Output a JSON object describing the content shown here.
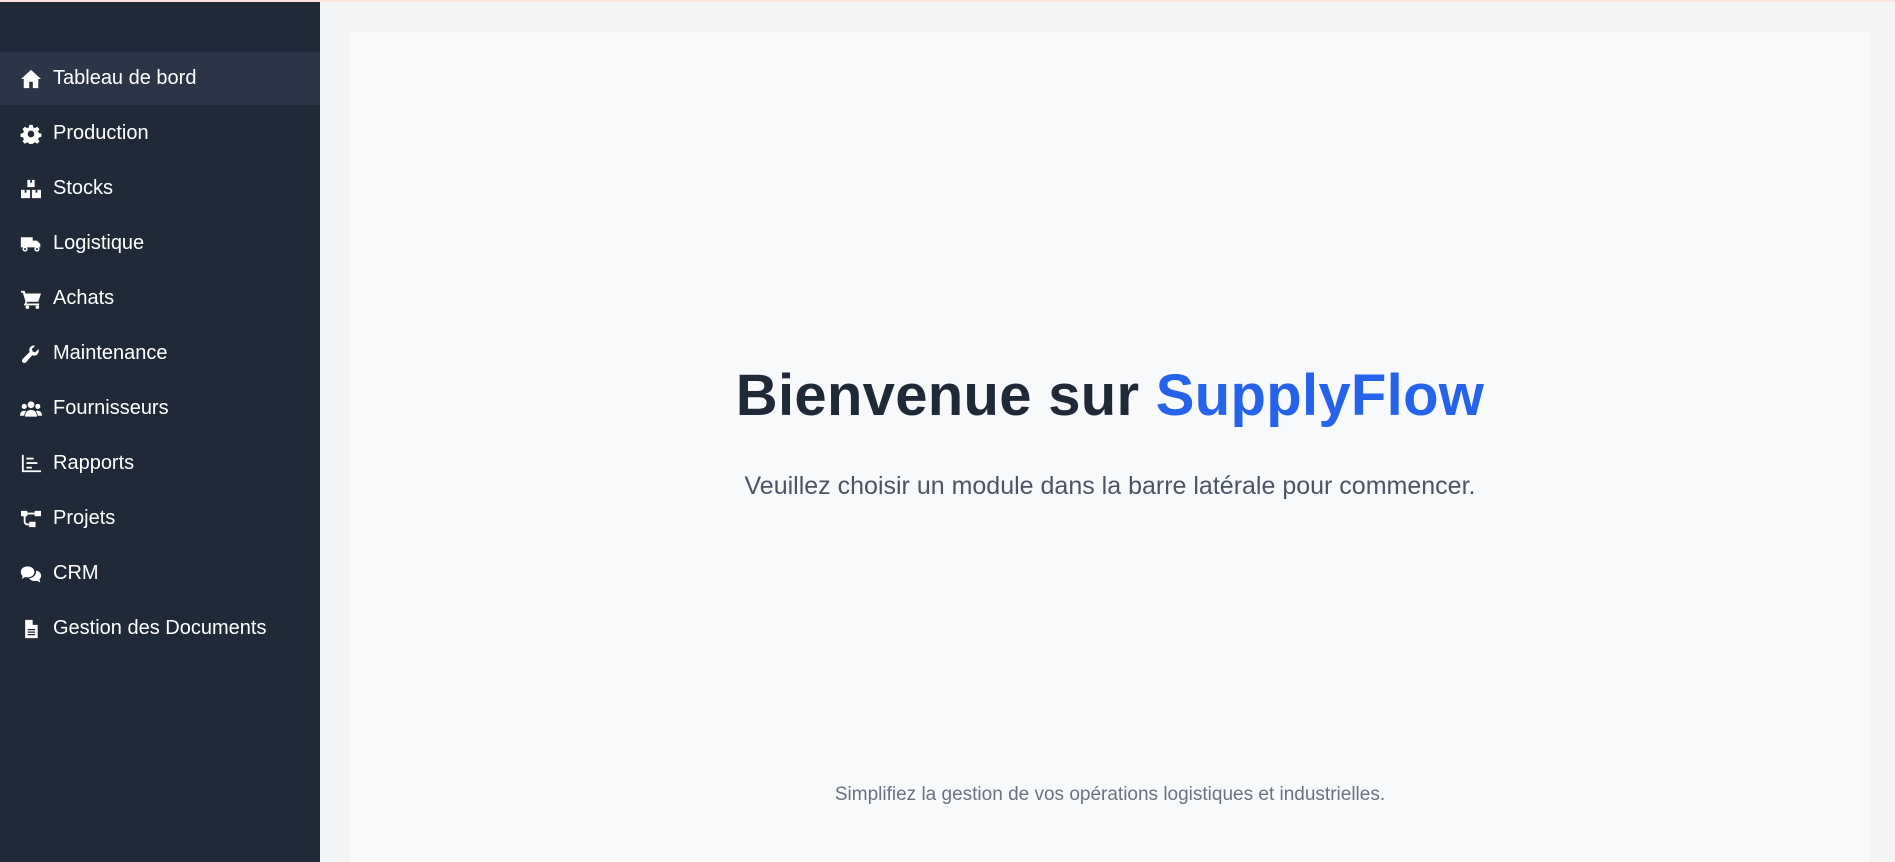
{
  "sidebar": {
    "items": [
      {
        "label": "Tableau de bord",
        "icon": "home-icon",
        "active": true
      },
      {
        "label": "Production",
        "icon": "gear-icon"
      },
      {
        "label": "Stocks",
        "icon": "boxes-icon"
      },
      {
        "label": "Logistique",
        "icon": "truck-icon"
      },
      {
        "label": "Achats",
        "icon": "cart-icon"
      },
      {
        "label": "Maintenance",
        "icon": "wrench-icon"
      },
      {
        "label": "Fournisseurs",
        "icon": "users-icon"
      },
      {
        "label": "Rapports",
        "icon": "chart-icon"
      },
      {
        "label": "Projets",
        "icon": "sitemap-icon"
      },
      {
        "label": "CRM",
        "icon": "comments-icon"
      },
      {
        "label": "Gestion des Documents",
        "icon": "document-icon"
      }
    ]
  },
  "main": {
    "welcome_prefix": "Bienvenue sur ",
    "brand": "SupplyFlow",
    "subtitle": "Veuillez choisir un module dans la barre latérale pour commencer.",
    "footer": "Simplifiez la gestion de vos opérations logistiques et industrielles."
  },
  "colors": {
    "sidebar_bg": "#1f2937",
    "sidebar_active": "#2b3547",
    "brand": "#2563eb",
    "main_bg": "#f8f9fb"
  }
}
